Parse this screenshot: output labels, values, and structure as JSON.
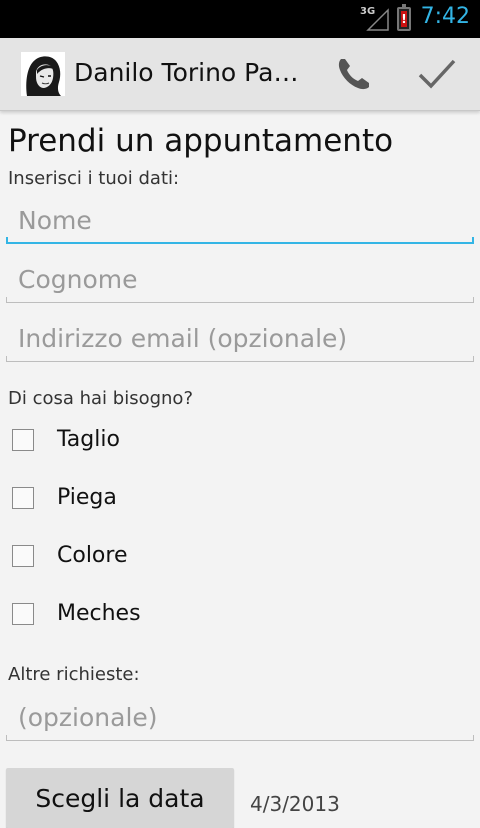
{
  "status_bar": {
    "network": "3G",
    "time": "7:42",
    "accent": "#33b5e5"
  },
  "action_bar": {
    "title": "Danilo Torino Parrucchieri",
    "call_icon": "phone-icon",
    "confirm_icon": "checkmark-icon"
  },
  "form": {
    "title": "Prendi un appuntamento",
    "data_label": "Inserisci i tuoi dati:",
    "fields": {
      "nome": {
        "value": "",
        "placeholder": "Nome"
      },
      "cognome": {
        "value": "",
        "placeholder": "Cognome"
      },
      "email": {
        "value": "",
        "placeholder": "Indirizzo email (opzionale)"
      }
    },
    "needs_label": "Di cosa hai bisogno?",
    "services": [
      {
        "label": "Taglio",
        "checked": false
      },
      {
        "label": "Piega",
        "checked": false
      },
      {
        "label": "Colore",
        "checked": false
      },
      {
        "label": "Meches",
        "checked": false
      }
    ],
    "other_label": "Altre richieste:",
    "other_field": {
      "value": "",
      "placeholder": "(opzionale)"
    },
    "date_button": "Scegli la data",
    "date_value": "4/3/2013"
  }
}
